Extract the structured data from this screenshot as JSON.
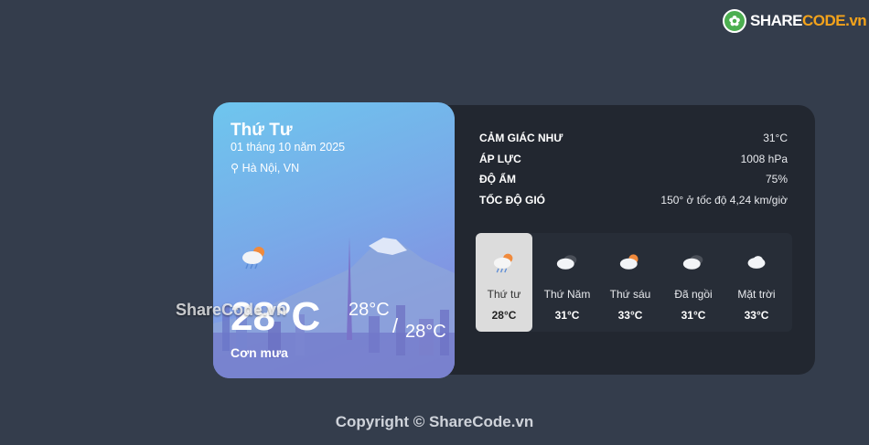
{
  "logo": {
    "mark": "✿",
    "part1": "SHARE",
    "part2": "CODE.vn"
  },
  "current": {
    "day": "Thứ Tư",
    "date": "01 tháng 10 năm 2025",
    "location_pin": "⚲",
    "location": "Hà Nội, VN",
    "icon": "rain-cloud-sun-icon",
    "temperature": "28°C",
    "high": "28°C",
    "slash": "/",
    "low": "28°C",
    "description": "Cơn mưa"
  },
  "details": [
    {
      "label": "CẢM GIÁC NHƯ",
      "value": "31°C"
    },
    {
      "label": "ÁP LỰC",
      "value": "1008 hPa"
    },
    {
      "label": "ĐỘ ẨM",
      "value": "75%"
    },
    {
      "label": "TỐC ĐỘ GIÓ",
      "value": "150° ở tốc độ 4,24 km/giờ"
    }
  ],
  "forecast": [
    {
      "day": "Thứ tư",
      "temp": "28°C",
      "icon": "rain-cloud-sun-icon",
      "selected": true
    },
    {
      "day": "Thứ Năm",
      "temp": "31°C",
      "icon": "dark-cloud-icon",
      "selected": false
    },
    {
      "day": "Thứ sáu",
      "temp": "33°C",
      "icon": "sun-cloud-icon",
      "selected": false
    },
    {
      "day": "Đã ngồi",
      "temp": "31°C",
      "icon": "dark-cloud-icon",
      "selected": false
    },
    {
      "day": "Mặt trời",
      "temp": "33°C",
      "icon": "cloud-icon",
      "selected": false
    }
  ],
  "watermark": "ShareCode.vn",
  "copyright": "Copyright © ShareCode.vn",
  "colors": {
    "background": "#343d4c",
    "panel": "#222730",
    "card_gradient_start": "#6ec6ee",
    "card_gradient_end": "#8a7fdc",
    "accent_logo": "#f3a31b"
  }
}
